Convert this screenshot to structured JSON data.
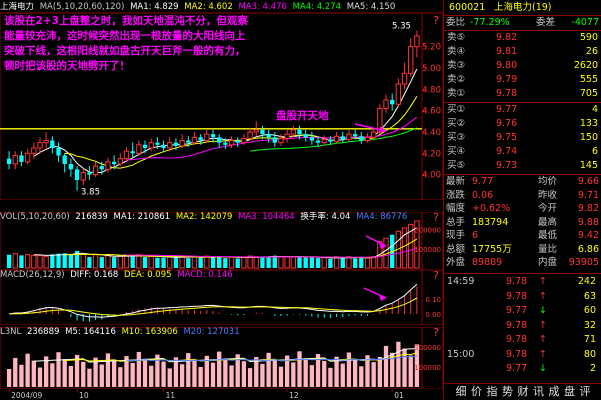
{
  "annotation_text": "该股在2+3上盘整之时，我如天地混沌不分，但观察能量较充沛，这时候突然出现一根放量的大阳线向上突破下线，这根阳线就如盘古开天巨斧一般的有力，顿时把该股的天地劈开了！",
  "callout_label": "盘股开天地",
  "price_panel": {
    "title": "上海电力",
    "indicator": "MA(5,10,20,60,120)",
    "ma1": "MA1: 4.829",
    "ma2": "MA2: 4.602",
    "ma3": "MA3: 4.476",
    "ma4": "MA4: 4.274",
    "ma5": "MA5: 4.150",
    "high_label": "5.35",
    "low_label": "3.85",
    "axis": [
      "5.20",
      "5.00",
      "4.80",
      "4.60",
      "4.40",
      "4.20",
      "4.00"
    ]
  },
  "vol_panel": {
    "label": "VOL(5,10,20,60)",
    "value": "216839",
    "ma1": "MA1: 210861",
    "ma2": "MA2: 142079",
    "ma3": "MA3: 104464",
    "turnover": "换手率: 4.04",
    "ma4": "MA4: 86776",
    "axis": [
      "200000",
      "100000"
    ]
  },
  "macd_panel": {
    "label": "MACD(26,12,9)",
    "diff": "DIFF: 0.168",
    "dea": "DEA: 0.095",
    "macd": "MACD: 0.146",
    "axis": [
      "0.10",
      "0.00"
    ]
  },
  "l3nl_panel": {
    "label": "L3NL",
    "value": "236889",
    "m5": "M5: 164116",
    "m10": "M10: 163906",
    "m20": "M20: 127031",
    "axis": [
      "200000",
      "100000"
    ]
  },
  "date_axis": [
    "2004/09",
    "10",
    "11",
    "12",
    "01"
  ],
  "colors": {
    "up": "#ff3333",
    "down": "#00ffff",
    "yellow": "#ffff00",
    "magenta": "#ff00ff",
    "green": "#00ff00",
    "white": "#ffffff",
    "annotation": "#ff00ff",
    "support": "#ffff00"
  },
  "quote": {
    "code": "600021",
    "name": "上海电力(19)",
    "wei_bi_label": "委比",
    "wei_bi_value": "-77.29%",
    "wei_cha_label": "委差",
    "wei_cha_value": "-4077",
    "asks": [
      {
        "label": "卖⑤",
        "price": "9.82",
        "vol": "590"
      },
      {
        "label": "卖④",
        "price": "9.81",
        "vol": "26"
      },
      {
        "label": "卖③",
        "price": "9.80",
        "vol": "2620"
      },
      {
        "label": "卖②",
        "price": "9.79",
        "vol": "555"
      },
      {
        "label": "卖①",
        "price": "9.78",
        "vol": "705"
      }
    ],
    "bids": [
      {
        "label": "买①",
        "price": "9.77",
        "vol": "4"
      },
      {
        "label": "买②",
        "price": "9.76",
        "vol": "133"
      },
      {
        "label": "买③",
        "price": "9.75",
        "vol": "150"
      },
      {
        "label": "买④",
        "price": "9.74",
        "vol": "6"
      },
      {
        "label": "买⑤",
        "price": "9.73",
        "vol": "145"
      }
    ],
    "stats": [
      {
        "l1": "最新",
        "v1": "9.77",
        "l2": "均价",
        "v2": "9.66"
      },
      {
        "l1": "涨跌",
        "v1": "0.06",
        "l2": "昨收",
        "v2": "9.71"
      },
      {
        "l1": "幅度",
        "v1": "+0.62%",
        "l2": "今开",
        "v2": "9.82"
      },
      {
        "l1": "总手",
        "v1": "183794",
        "l2": "最高",
        "v2": "9.88"
      },
      {
        "l1": "现手",
        "v1": "6",
        "l2": "最低",
        "v2": "9.42"
      },
      {
        "l1": "总额",
        "v1": "17755万",
        "l2": "量比",
        "v2": "6.86"
      },
      {
        "l1": "外盘",
        "v1": "89889",
        "l2": "内盘",
        "v2": "93905"
      }
    ],
    "ticks": [
      {
        "time": "14:59",
        "price": "9.78",
        "arrow": "↑",
        "vol": "242"
      },
      {
        "time": "",
        "price": "9.78",
        "arrow": "↑",
        "vol": "63"
      },
      {
        "time": "",
        "price": "9.77",
        "arrow": "↓",
        "vol": "60"
      },
      {
        "time": "",
        "price": "9.78",
        "arrow": "↑",
        "vol": "32"
      },
      {
        "time": "",
        "price": "9.78",
        "arrow": "↑",
        "vol": "71"
      },
      {
        "time": "15:00",
        "price": "9.78",
        "arrow": "↑",
        "vol": "80"
      },
      {
        "time": "",
        "price": "9.77",
        "arrow": "↓",
        "vol": "2"
      }
    ],
    "tabs": [
      "细",
      "价",
      "指",
      "势",
      "财",
      "讯",
      "成",
      "盘",
      "评"
    ]
  },
  "chart_data": [
    {
      "type": "candlestick",
      "title": "上海电力",
      "ylim": [
        3.8,
        5.45
      ],
      "high": 5.35,
      "low": 3.85,
      "support_level": 4.43,
      "candles": [
        [
          4.15,
          4.1,
          4.22,
          4.05
        ],
        [
          4.1,
          4.18,
          4.22,
          4.05
        ],
        [
          4.18,
          4.12,
          4.22,
          4.08
        ],
        [
          4.12,
          4.2,
          4.24,
          4.1
        ],
        [
          4.2,
          4.25,
          4.3,
          4.15
        ],
        [
          4.25,
          4.3,
          4.35,
          4.2
        ],
        [
          4.3,
          4.32,
          4.4,
          4.25
        ],
        [
          4.32,
          4.25,
          4.36,
          4.2
        ],
        [
          4.25,
          4.18,
          4.3,
          4.12
        ],
        [
          4.18,
          4.1,
          4.2,
          4.02
        ],
        [
          4.1,
          4.05,
          4.15,
          3.98
        ],
        [
          4.05,
          3.95,
          4.08,
          3.85
        ],
        [
          3.95,
          4.02,
          4.06,
          3.9
        ],
        [
          4.02,
          4.0,
          4.08,
          3.95
        ],
        [
          4.0,
          4.08,
          4.12,
          3.98
        ],
        [
          4.08,
          4.05,
          4.12,
          4.0
        ],
        [
          4.05,
          4.12,
          4.16,
          4.02
        ],
        [
          4.12,
          4.1,
          4.18,
          4.05
        ],
        [
          4.1,
          4.15,
          4.2,
          4.08
        ],
        [
          4.15,
          4.22,
          4.26,
          4.12
        ],
        [
          4.22,
          4.2,
          4.3,
          4.15
        ],
        [
          4.2,
          4.28,
          4.32,
          4.18
        ],
        [
          4.28,
          4.25,
          4.32,
          4.2
        ],
        [
          4.25,
          4.3,
          4.34,
          4.22
        ],
        [
          4.3,
          4.28,
          4.35,
          4.24
        ],
        [
          4.28,
          4.25,
          4.32,
          4.22
        ],
        [
          4.25,
          4.3,
          4.35,
          4.22
        ],
        [
          4.3,
          4.27,
          4.34,
          4.23
        ],
        [
          4.27,
          4.32,
          4.38,
          4.25
        ],
        [
          4.32,
          4.3,
          4.36,
          4.26
        ],
        [
          4.3,
          4.35,
          4.4,
          4.28
        ],
        [
          4.35,
          4.32,
          4.38,
          4.28
        ],
        [
          4.32,
          4.38,
          4.42,
          4.3
        ],
        [
          4.38,
          4.35,
          4.42,
          4.3
        ],
        [
          4.35,
          4.3,
          4.38,
          4.25
        ],
        [
          4.3,
          4.28,
          4.34,
          4.24
        ],
        [
          4.28,
          4.32,
          4.36,
          4.25
        ],
        [
          4.32,
          4.3,
          4.35,
          4.26
        ],
        [
          4.3,
          4.34,
          4.38,
          4.28
        ],
        [
          4.34,
          4.4,
          4.44,
          4.32
        ],
        [
          4.4,
          4.42,
          4.5,
          4.36
        ],
        [
          4.42,
          4.38,
          4.46,
          4.33
        ],
        [
          4.38,
          4.35,
          4.42,
          4.3
        ],
        [
          4.35,
          4.3,
          4.4,
          4.26
        ],
        [
          4.3,
          4.34,
          4.38,
          4.27
        ],
        [
          4.34,
          4.38,
          4.42,
          4.3
        ],
        [
          4.38,
          4.42,
          4.46,
          4.35
        ],
        [
          4.42,
          4.38,
          4.46,
          4.33
        ],
        [
          4.38,
          4.35,
          4.42,
          4.31
        ],
        [
          4.35,
          4.32,
          4.4,
          4.28
        ],
        [
          4.32,
          4.3,
          4.36,
          4.26
        ],
        [
          4.3,
          4.33,
          4.37,
          4.27
        ],
        [
          4.33,
          4.31,
          4.36,
          4.28
        ],
        [
          4.31,
          4.36,
          4.4,
          4.29
        ],
        [
          4.36,
          4.33,
          4.4,
          4.3
        ],
        [
          4.33,
          4.38,
          4.42,
          4.31
        ],
        [
          4.38,
          4.36,
          4.42,
          4.33
        ],
        [
          4.36,
          4.32,
          4.4,
          4.29
        ],
        [
          4.32,
          4.35,
          4.39,
          4.3
        ],
        [
          4.35,
          4.4,
          4.44,
          4.33
        ],
        [
          4.4,
          4.62,
          4.66,
          4.38
        ],
        [
          4.62,
          4.7,
          4.75,
          4.58
        ],
        [
          4.7,
          4.66,
          4.76,
          4.6
        ],
        [
          4.66,
          4.85,
          4.9,
          4.64
        ],
        [
          4.85,
          4.95,
          5.05,
          4.8
        ],
        [
          4.95,
          5.2,
          5.28,
          4.92
        ],
        [
          5.2,
          5.3,
          5.35,
          5.1
        ]
      ]
    }
  ]
}
